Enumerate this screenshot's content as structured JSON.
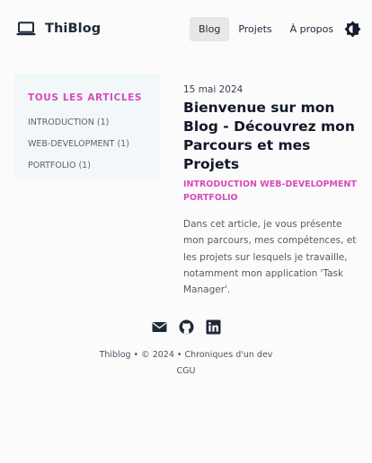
{
  "header": {
    "brand": "ThiBlog",
    "nav": [
      {
        "label": "Blog",
        "active": true
      },
      {
        "label": "Projets",
        "active": false
      },
      {
        "label": "À propos",
        "active": false
      }
    ],
    "theme_toggle_icon": "contrast-icon"
  },
  "sidebar": {
    "title": "TOUS LES ARTICLES",
    "items": [
      {
        "label": "INTRODUCTION (1)"
      },
      {
        "label": "WEB-DEVELOPMENT (1)"
      },
      {
        "label": "PORTFOLIO (1)"
      }
    ]
  },
  "post": {
    "date": "15 mai 2024",
    "title": "Bienvenue sur mon Blog - Découvrez mon Parcours et mes Projets",
    "tags": [
      "INTRODUCTION",
      "WEB-DEVELOPMENT",
      "PORTFOLIO"
    ],
    "excerpt": "Dans cet article, je vous présente mon parcours, mes compétences, et les projets sur lesquels je travaille, notamment mon application 'Task Manager'."
  },
  "footer": {
    "social_icons": [
      "mail-icon",
      "github-icon",
      "linkedin-icon"
    ],
    "copyright": "Thiblog • © 2024 • Chroniques d'un dev",
    "cgu": "CGU"
  },
  "colors": {
    "accent": "#d84bb8",
    "sidebar_bg": "#f2f7fa",
    "nav_active_bg": "#e7e7e7"
  }
}
